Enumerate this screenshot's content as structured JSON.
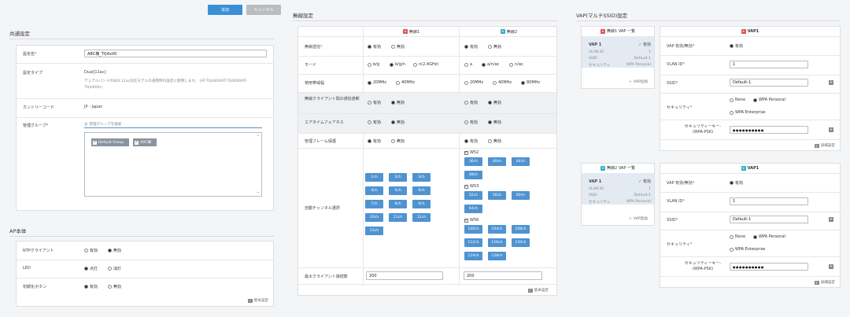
{
  "toolbar": {
    "save": "追加",
    "cancel": "キャンセル"
  },
  "common": {
    "title": "共通設定",
    "name_label": "設定名",
    "name_value": "ABC棟_TQ4x00",
    "type_label": "設定タイプ",
    "type_value": "Dual[11ac]",
    "type_desc": "デュアルバンドの802.11ac対応モデルの運用時の設定に使用します。 (AT-TQ4400/AT-TQ4600/AT-TQ4400e)",
    "country_label": "カントリーコード",
    "country_value": "JP - Japan",
    "group_label": "管理グループ",
    "group_search_placeholder": "管理グループを検索",
    "groups": [
      "Default Group",
      "ABC棟"
    ]
  },
  "ap": {
    "title": "AP本体",
    "ntp_label": "NTPクライアント",
    "ntp_on": "有効",
    "ntp_off": "無効",
    "led_label": "LED",
    "led_on": "点灯",
    "led_off": "消灯",
    "init_label": "初期化ボタン",
    "init_on": "有効",
    "init_off": "無効",
    "basic": "基本設定"
  },
  "wireless": {
    "title": "無線設定",
    "col1": "無線1",
    "col2": "無線2",
    "rows": {
      "tx": "無線送信",
      "mode": "モード",
      "band": "使用帯域幅",
      "isolation": "無線クライアント間の通信遮断",
      "airtime": "エアタイムフェアネス",
      "mgmt": "管理フレーム保護",
      "autoch": "自動チャンネル選択",
      "maxcli": "最大クライアント接続数"
    },
    "on": "有効",
    "off": "無効",
    "mode1": [
      "b/g",
      "b/g/n",
      "n(2.4GHz)"
    ],
    "mode2": [
      "a",
      "a/n/ac",
      "n/ac"
    ],
    "band1": [
      "20MHz",
      "40MHz"
    ],
    "band2": [
      "20MHz",
      "40MHz",
      "80MHz"
    ],
    "ch1": [
      "1ch",
      "2ch",
      "3ch",
      "4ch",
      "5ch",
      "6ch",
      "7ch",
      "8ch",
      "9ch",
      "10ch",
      "11ch",
      "12ch",
      "13ch"
    ],
    "w52": "W52",
    "w53": "W53",
    "w56": "W56",
    "ch_w52": [
      "36ch",
      "40ch",
      "44ch",
      "48ch"
    ],
    "ch_w53": [
      "52ch",
      "56ch",
      "60ch",
      "64ch"
    ],
    "ch_w56": [
      "100ch",
      "104ch",
      "108ch",
      "112ch",
      "116ch",
      "120ch",
      "124ch",
      "128ch"
    ],
    "max1": "200",
    "max2": "200",
    "basic": "基本設定"
  },
  "vap": {
    "title": "VAP(マルチSSID)設定",
    "list1": "無線1 VAP 一覧",
    "list2": "無線2 VAP 一覧",
    "item": "VAP 1",
    "item_status": "有効",
    "vlan_k": "VLAN ID",
    "vlan_v": "1",
    "ssid_k": "SSID",
    "ssid_v": "Default-1",
    "sec_k": "セキュリティ",
    "sec_v": "WPA Personal",
    "add": "VAP追加",
    "detail_title": "VAP1",
    "enable_label": "VAP 有効/無効",
    "enable_val": "有効",
    "vlan_label": "VLAN ID",
    "vlan_val": "1",
    "ssid_label": "SSID",
    "ssid_val": "Default-1",
    "security_label": "セキュリティ",
    "opt_none": "None",
    "opt_wpap": "WPA Personal",
    "opt_wpae": "WPA Enterprise",
    "key_label": "セキュリティーキー-\n(WPA-PSK)",
    "key_val": "●●●●●●●●●●",
    "detail": "詳細設定"
  }
}
